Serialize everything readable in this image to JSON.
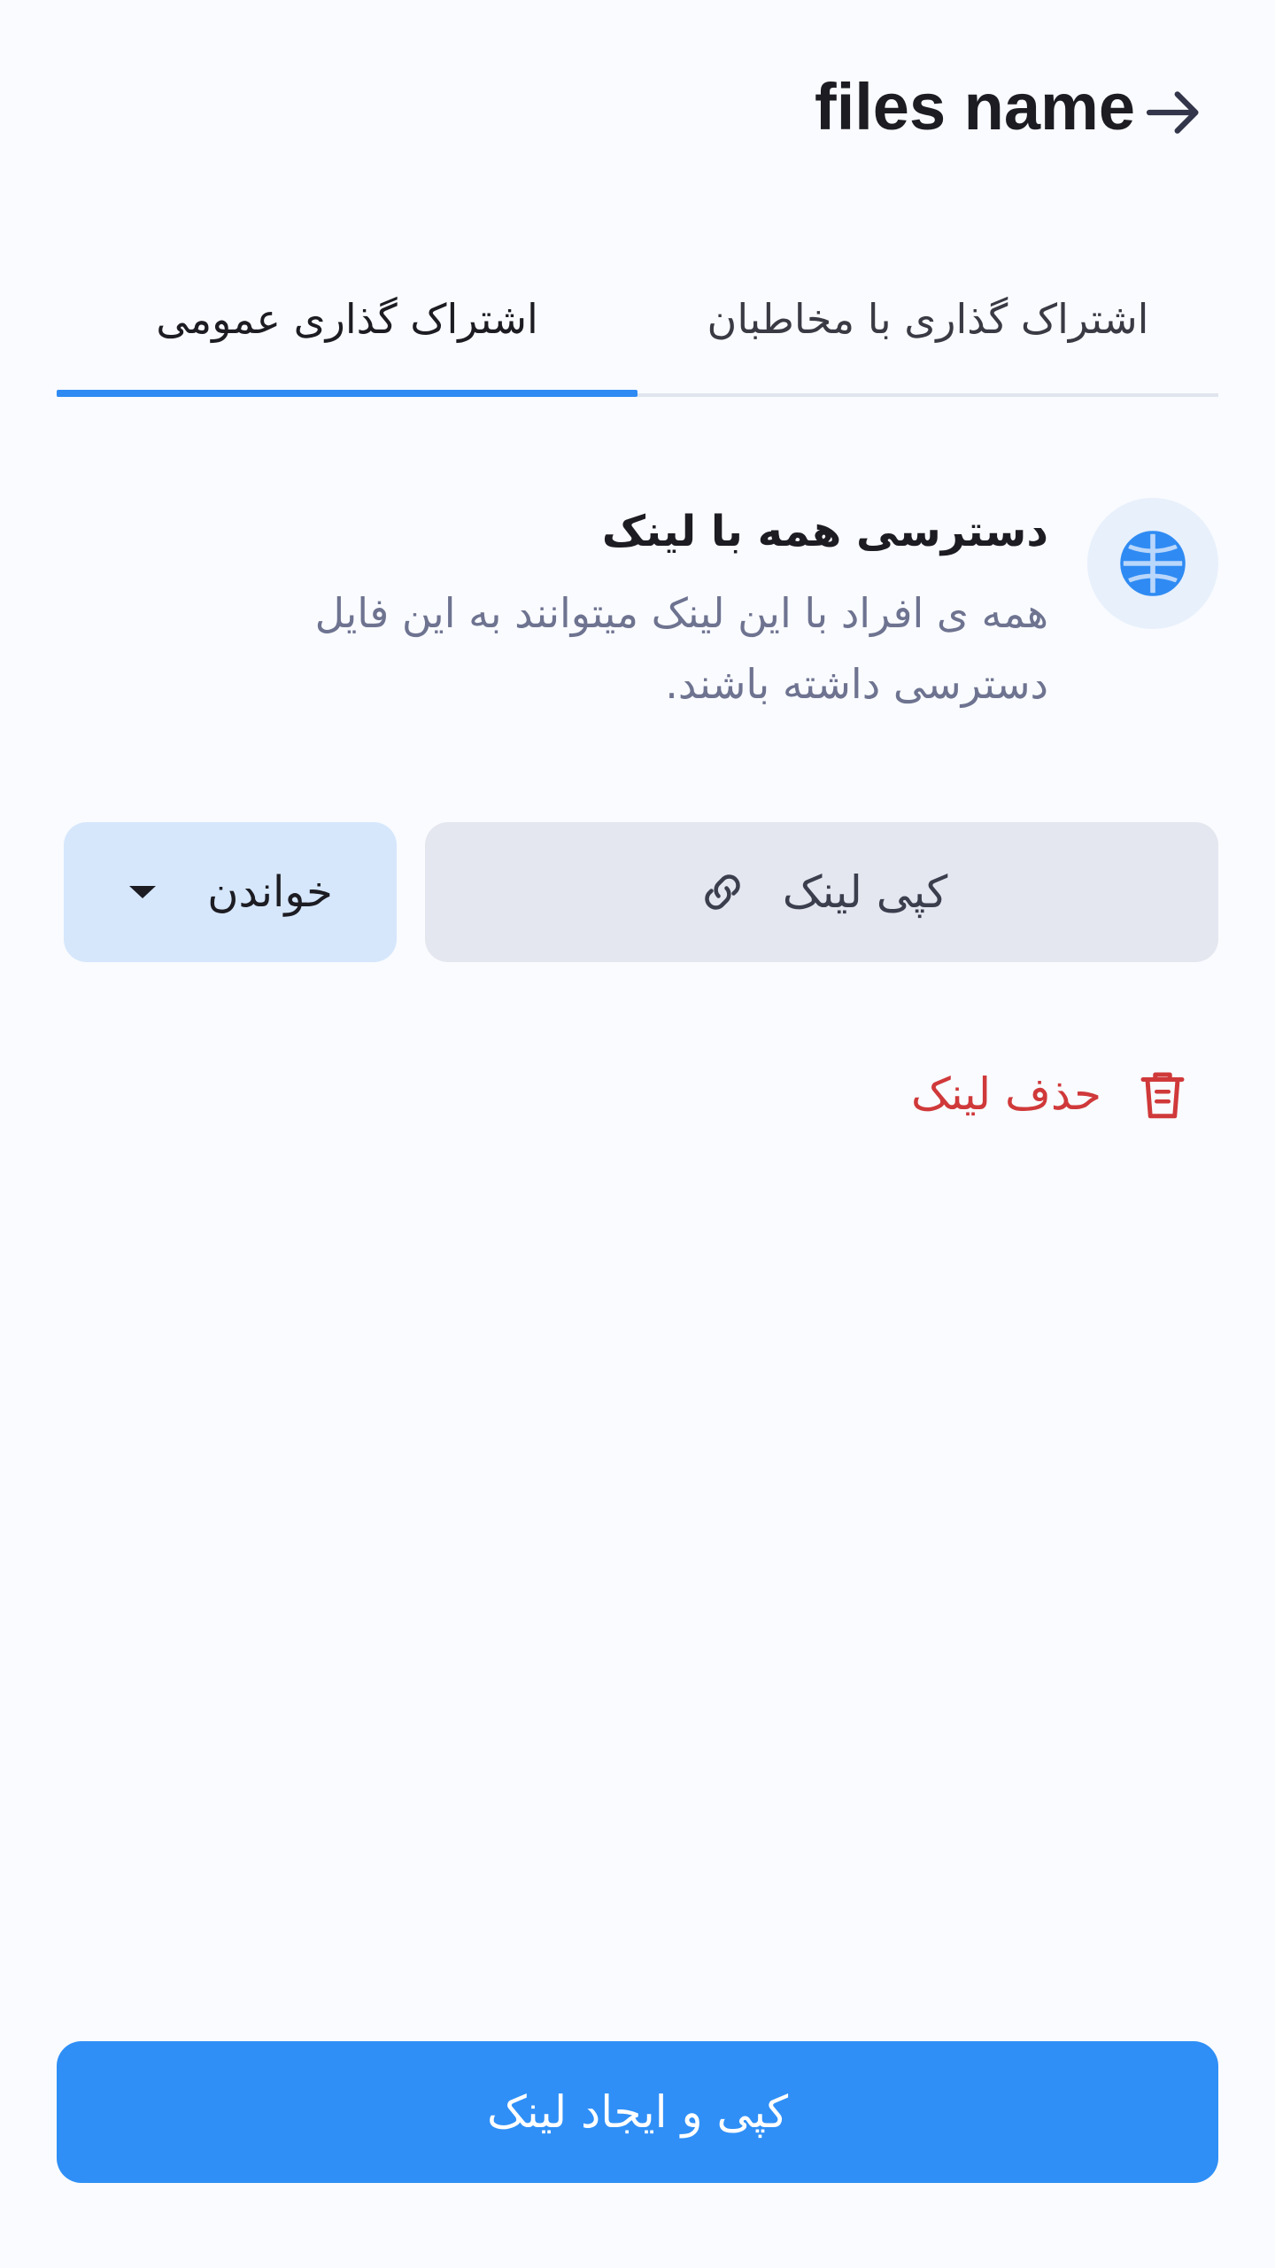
{
  "header": {
    "title": "files name",
    "back_icon": "arrow-right-icon"
  },
  "tabs": [
    {
      "label": "اشتراک گذاری با مخاطبان",
      "active": false
    },
    {
      "label": "اشتراک گذاری عمومی",
      "active": true
    }
  ],
  "info": {
    "icon": "globe-icon",
    "title": "دسترسی همه با لینک",
    "description_line1": "همه ی افراد با این لینک میتوانند به این فایل",
    "description_line2": "دسترسی داشته باشند."
  },
  "actions": {
    "copy_link_label": "کپی لینک",
    "copy_link_icon": "link-icon",
    "permission_label": "خواندن",
    "permission_icon": "caret-down-icon"
  },
  "delete": {
    "label": "حذف لینک",
    "icon": "trash-icon"
  },
  "cta": {
    "label": "کپی و ایجاد لینک"
  },
  "colors": {
    "accent": "#2f8ff6",
    "danger": "#d0393a",
    "background": "#f9fbff"
  }
}
